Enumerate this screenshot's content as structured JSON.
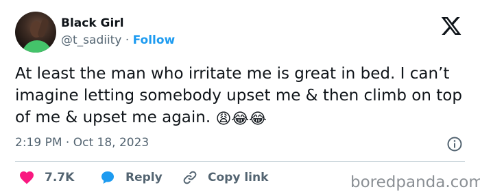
{
  "author": {
    "name": "Black Girl",
    "handle": "@t_sadiity",
    "separator": "·",
    "follow_label": "Follow"
  },
  "tweet": {
    "text": "At least the man who irritate me is great in bed. I can’t imagine letting somebody upset me & then climb on top of me & upset me again.",
    "emojis": [
      "😩",
      "😂",
      "😂"
    ]
  },
  "meta": {
    "time": "2:19 PM",
    "separator": "·",
    "date": "Oct 18, 2023"
  },
  "actions": {
    "like_count": "7.7K",
    "reply_label": "Reply",
    "copy_link_label": "Copy link"
  },
  "watermark": "boredpanda.com",
  "colors": {
    "like_heart": "#f91880",
    "reply_bubble": "#1d9bf0",
    "follow_link": "#1d9bf0",
    "muted_text": "#536471"
  },
  "icons": {
    "platform": "x-logo-icon",
    "info": "info-icon",
    "like": "heart-icon",
    "reply": "speech-bubble-icon",
    "copy_link": "link-icon"
  }
}
